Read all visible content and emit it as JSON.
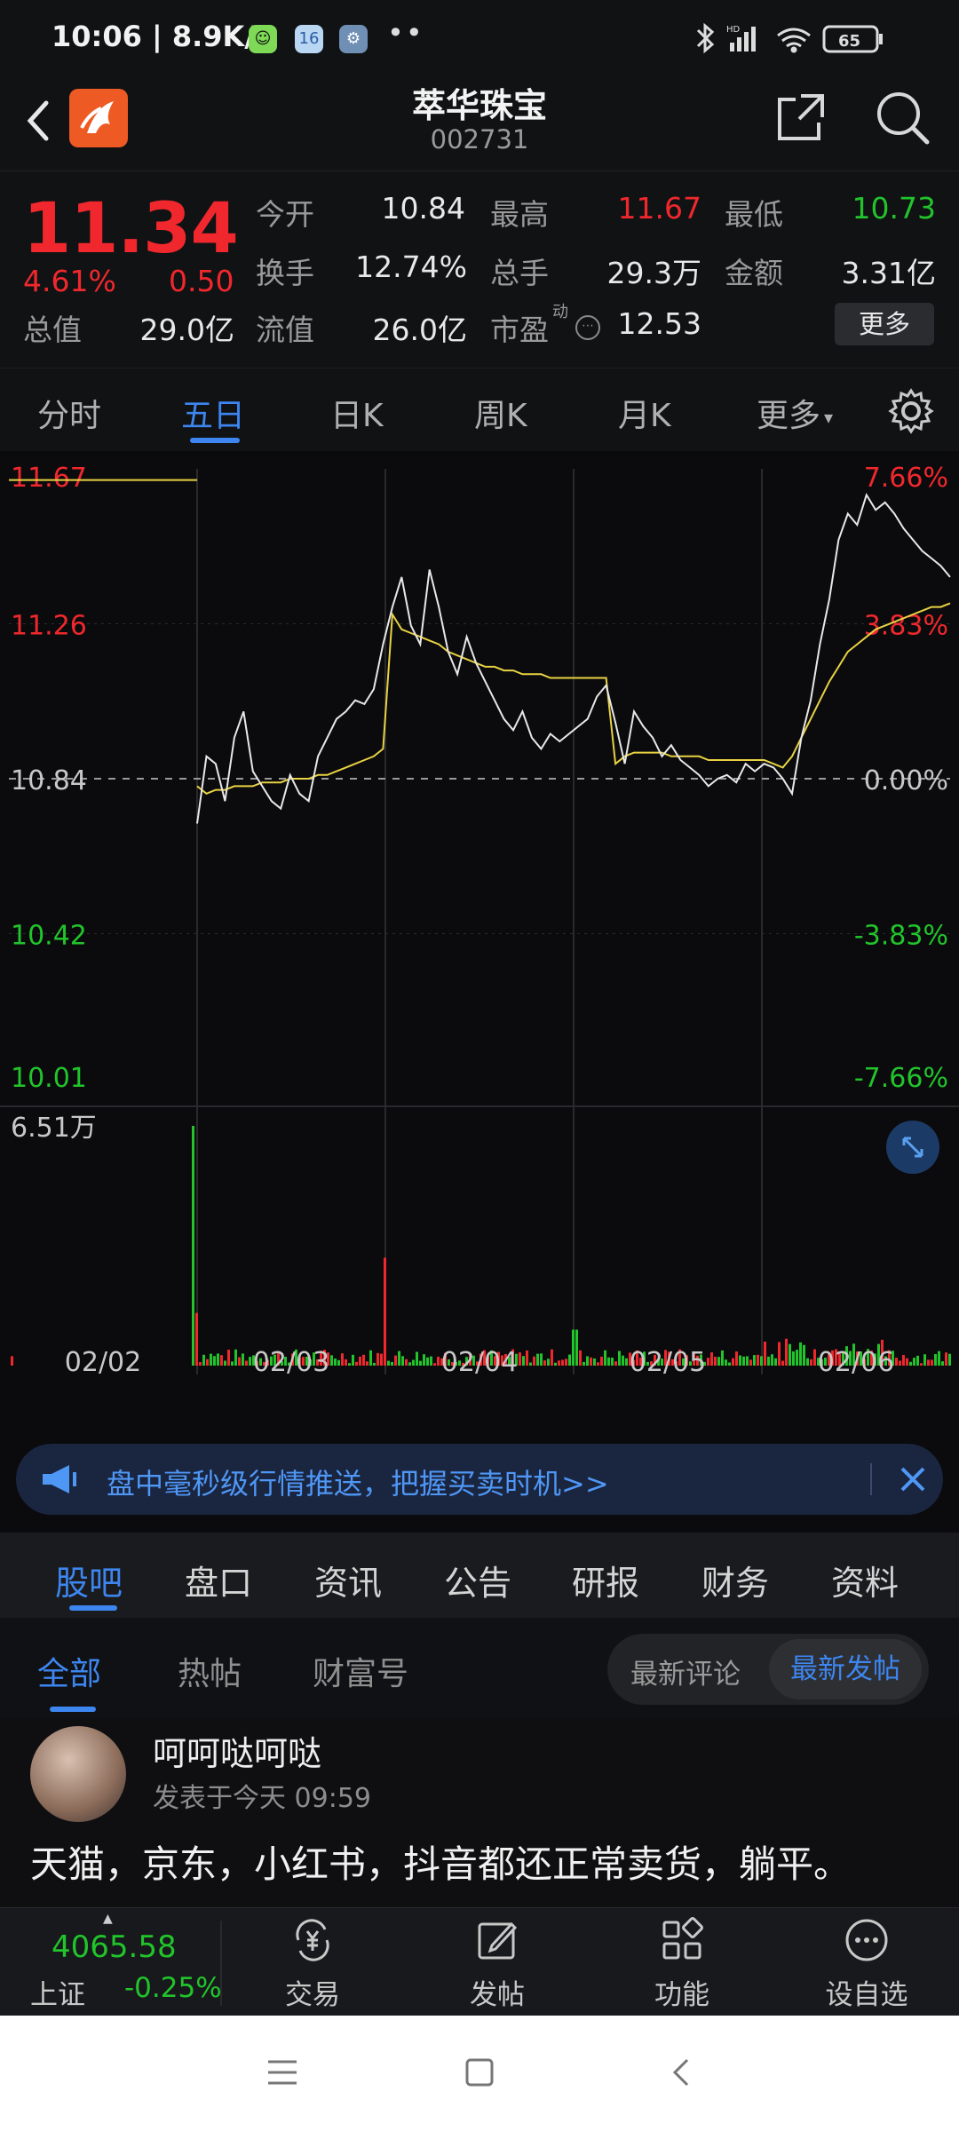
{
  "status_bar": {
    "time_speed": "10:06 | 8.9K/s",
    "badge_app2": "16",
    "battery": "65"
  },
  "header": {
    "title": "萃华珠宝",
    "code": "002731"
  },
  "quote": {
    "price": "11.34",
    "change_pct": "4.61%",
    "change": "0.50",
    "labels": {
      "open": "今开",
      "high": "最高",
      "low": "最低",
      "turnover": "换手",
      "volume": "总手",
      "amount": "金额",
      "total_cap": "总值",
      "float_cap": "流值",
      "pe": "市盈",
      "pe_tag": "动"
    },
    "values": {
      "open": "10.84",
      "high": "11.67",
      "low": "10.73",
      "turnover": "12.74%",
      "volume": "29.3万",
      "amount": "3.31亿",
      "total_cap": "29.0亿",
      "float_cap": "26.0亿",
      "pe": "12.53"
    },
    "more_button": "更多"
  },
  "tabs": [
    {
      "label": "分时"
    },
    {
      "label": "五日"
    },
    {
      "label": "日K"
    },
    {
      "label": "周K"
    },
    {
      "label": "月K"
    },
    {
      "label": "更多"
    }
  ],
  "active_tab": "五日",
  "chart_data": {
    "type": "line",
    "price_axis_left": [
      "11.67",
      "11.26",
      "10.84",
      "10.42",
      "10.01"
    ],
    "price_axis_right": [
      "7.66%",
      "3.83%",
      "0.00%",
      "-3.83%",
      "-7.66%"
    ],
    "volume_max_label": "6.51万",
    "x_labels": [
      "02/02",
      "02/03",
      "02/04",
      "02/05",
      "02/06"
    ],
    "ylim": [
      10.01,
      11.67
    ],
    "prev_close": 10.84,
    "series": [
      {
        "key": "price",
        "values": [
          10.72,
          10.9,
          10.88,
          10.78,
          10.95,
          11.02,
          10.86,
          10.82,
          10.78,
          10.76,
          10.85,
          10.8,
          10.78,
          10.9,
          10.95,
          11.0,
          11.02,
          11.05,
          11.04,
          11.08,
          11.2,
          11.3,
          11.38,
          11.25,
          11.2,
          11.4,
          11.3,
          11.18,
          11.12,
          11.22,
          11.15,
          11.1,
          11.05,
          11.0,
          10.97,
          11.02,
          10.95,
          10.92,
          10.96,
          10.94,
          10.96,
          10.98,
          11.0,
          11.06,
          11.09,
          10.99,
          10.88,
          11.02,
          10.98,
          10.95,
          10.9,
          10.93,
          10.89,
          10.87,
          10.85,
          10.82,
          10.84,
          10.85,
          10.83,
          10.88,
          10.86,
          10.88,
          10.87,
          10.84,
          10.8,
          10.95,
          11.05,
          11.2,
          11.32,
          11.48,
          11.55,
          11.52,
          11.6,
          11.56,
          11.58,
          11.55,
          11.51,
          11.48,
          11.45,
          11.43,
          11.41,
          11.38
        ]
      },
      {
        "key": "avg",
        "values": [
          10.82,
          10.8,
          10.81,
          10.81,
          10.82,
          10.82,
          10.82,
          10.83,
          10.83,
          10.83,
          10.84,
          10.84,
          10.84,
          10.85,
          10.85,
          10.86,
          10.87,
          10.88,
          10.89,
          10.9,
          10.92,
          11.28,
          11.24,
          11.23,
          11.22,
          11.21,
          11.2,
          11.18,
          11.17,
          11.16,
          11.15,
          11.14,
          11.14,
          11.13,
          11.13,
          11.12,
          11.12,
          11.12,
          11.11,
          11.11,
          11.11,
          11.11,
          11.11,
          11.11,
          11.11,
          10.88,
          10.9,
          10.91,
          10.91,
          10.91,
          10.91,
          10.9,
          10.9,
          10.9,
          10.9,
          10.89,
          10.89,
          10.89,
          10.89,
          10.89,
          10.89,
          10.89,
          10.88,
          10.87,
          10.9,
          10.95,
          11.0,
          11.05,
          11.1,
          11.14,
          11.18,
          11.2,
          11.22,
          11.24,
          11.25,
          11.26,
          11.27,
          11.28,
          11.29,
          11.3,
          11.3,
          11.31
        ]
      },
      {
        "key": "yesterday_line",
        "values": [
          11.64,
          11.64
        ]
      }
    ],
    "colors": {
      "price": "#e8e8e8",
      "avg": "#e8d243",
      "up": "#f0282d",
      "down": "#21c42b",
      "grid": "#2a2a2e",
      "axis_up": "#f0282d",
      "axis_down": "#21c42b",
      "axis_neutral": "#c8c8c8"
    }
  },
  "promo": {
    "text": "盘中毫秒级行情推送，把握买卖时机>>"
  },
  "sub_tabs": [
    {
      "label": "股吧"
    },
    {
      "label": "盘口"
    },
    {
      "label": "资讯"
    },
    {
      "label": "公告"
    },
    {
      "label": "研报"
    },
    {
      "label": "财务"
    },
    {
      "label": "资料"
    }
  ],
  "filter": {
    "tabs": [
      {
        "label": "全部"
      },
      {
        "label": "热帖"
      },
      {
        "label": "财富号"
      }
    ],
    "sort_left": "最新评论",
    "sort_right": "最新发帖"
  },
  "post": {
    "username": "呵呵哒呵哒",
    "time": "发表于今天 09:59",
    "content": "天猫，京东，小红书，抖音都还正常卖货，躺平。"
  },
  "bottom_nav": {
    "index_value": "4065.58",
    "index_name": "上证",
    "index_pct": "-0.25%",
    "items": [
      {
        "label": "交易",
        "icon": "yuan-exchange-icon"
      },
      {
        "label": "发帖",
        "icon": "edit-post-icon"
      },
      {
        "label": "功能",
        "icon": "grid-apps-icon"
      },
      {
        "label": "设自选",
        "icon": "more-circle-icon"
      }
    ]
  }
}
